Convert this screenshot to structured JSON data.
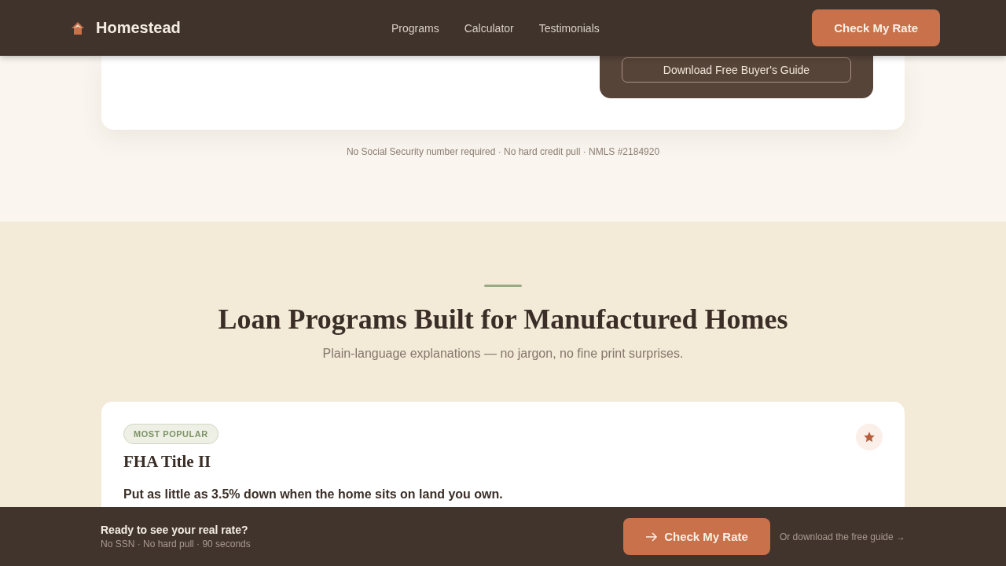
{
  "header": {
    "brand": "Homestead",
    "nav": [
      "Programs",
      "Calculator",
      "Testimonials"
    ],
    "cta": "Check My Rate"
  },
  "hero_card": {
    "guide_button": "Download Free Buyer's Guide"
  },
  "trust_note": "No Social Security number required · No hard credit pull · NMLS #2184920",
  "programs": {
    "title": "Loan Programs Built for Manufactured Homes",
    "subtitle": "Plain-language explanations — no jargon, no fine print surprises.",
    "cards": [
      {
        "badge": "MOST POPULAR",
        "name": "FHA Title II",
        "summary": "Put as little as 3.5% down when the home sits on land you own."
      }
    ]
  },
  "sticky_bar": {
    "title": "Ready to see your real rate?",
    "subtitle": "No SSN · No hard pull · 90 seconds",
    "cta": "Check My Rate",
    "link": "Or download the free guide →"
  }
}
